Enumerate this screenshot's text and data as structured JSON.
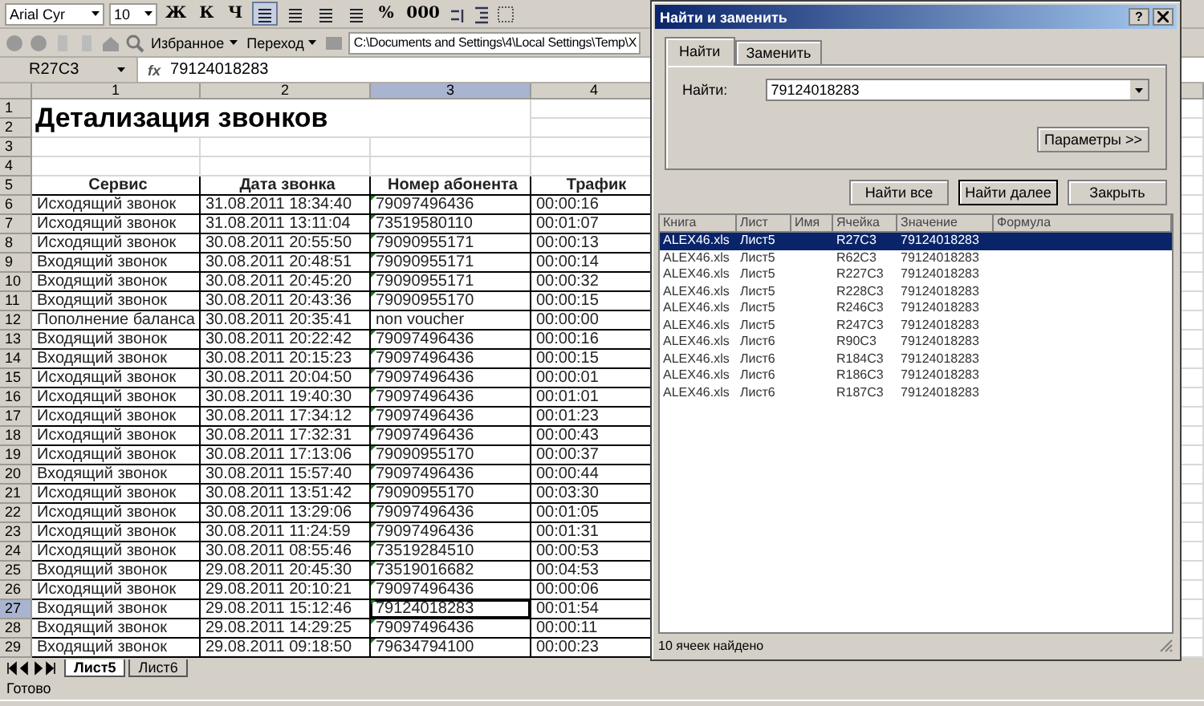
{
  "toolbar": {
    "font": "Arial Cyr",
    "size": "10",
    "format_buttons": [
      "Ж",
      "К",
      "Ч"
    ],
    "number_buttons": [
      "%",
      "000"
    ]
  },
  "web_toolbar": {
    "favorites": "Избранное",
    "go": "Переход",
    "address": "C:\\Documents and Settings\\4\\Local Settings\\Temp\\X"
  },
  "formula_bar": {
    "name_box": "R27C3",
    "fx": "fx",
    "value": "79124018283"
  },
  "columns": [
    {
      "label": "1",
      "selected": false
    },
    {
      "label": "2",
      "selected": false
    },
    {
      "label": "3",
      "selected": true
    },
    {
      "label": "4",
      "selected": false
    }
  ],
  "top_rows": [
    "1",
    "2",
    "3",
    "4",
    "5"
  ],
  "title": "Детализация звонков",
  "table_header": [
    "Сервис",
    "Дата звонка",
    "Номер абонента",
    "Трафик"
  ],
  "rows": [
    {
      "number": "6",
      "selected": false,
      "cells": [
        "Исходящий звонок",
        "31.08.2011 18:34:40",
        "79097496436",
        "00:00:16"
      ],
      "flag": true
    },
    {
      "number": "7",
      "selected": false,
      "cells": [
        "Исходящий звонок",
        "31.08.2011 13:11:04",
        "73519580110",
        "00:01:07"
      ],
      "flag": true
    },
    {
      "number": "8",
      "selected": false,
      "cells": [
        "Исходящий звонок",
        "30.08.2011 20:55:50",
        "79090955171",
        "00:00:13"
      ],
      "flag": true
    },
    {
      "number": "9",
      "selected": false,
      "cells": [
        "Входящий звонок",
        "30.08.2011 20:48:51",
        "79090955171",
        "00:00:14"
      ],
      "flag": true
    },
    {
      "number": "10",
      "selected": false,
      "cells": [
        "Входящий звонок",
        "30.08.2011 20:45:20",
        "79090955171",
        "00:00:32"
      ],
      "flag": true
    },
    {
      "number": "11",
      "selected": false,
      "cells": [
        "Входящий звонок",
        "30.08.2011 20:43:36",
        "79090955170",
        "00:00:15"
      ],
      "flag": true
    },
    {
      "number": "12",
      "selected": false,
      "cells": [
        "Пополнение баланса",
        "30.08.2011 20:35:41",
        "non voucher",
        "00:00:00"
      ],
      "flag": false
    },
    {
      "number": "13",
      "selected": false,
      "cells": [
        "Входящий звонок",
        "30.08.2011 20:22:42",
        "79097496436",
        "00:00:16"
      ],
      "flag": true
    },
    {
      "number": "14",
      "selected": false,
      "cells": [
        "Входящий звонок",
        "30.08.2011 20:15:23",
        "79097496436",
        "00:00:15"
      ],
      "flag": true
    },
    {
      "number": "15",
      "selected": false,
      "cells": [
        "Исходящий звонок",
        "30.08.2011 20:04:50",
        "79097496436",
        "00:00:01"
      ],
      "flag": true
    },
    {
      "number": "16",
      "selected": false,
      "cells": [
        "Исходящий звонок",
        "30.08.2011 19:40:30",
        "79097496436",
        "00:01:01"
      ],
      "flag": true
    },
    {
      "number": "17",
      "selected": false,
      "cells": [
        "Исходящий звонок",
        "30.08.2011 17:34:12",
        "79097496436",
        "00:01:23"
      ],
      "flag": true
    },
    {
      "number": "18",
      "selected": false,
      "cells": [
        "Исходящий звонок",
        "30.08.2011 17:32:31",
        "79097496436",
        "00:00:43"
      ],
      "flag": true
    },
    {
      "number": "19",
      "selected": false,
      "cells": [
        "Исходящий звонок",
        "30.08.2011 17:13:06",
        "79090955170",
        "00:00:37"
      ],
      "flag": true
    },
    {
      "number": "20",
      "selected": false,
      "cells": [
        "Входящий звонок",
        "30.08.2011 15:57:40",
        "79097496436",
        "00:00:44"
      ],
      "flag": true
    },
    {
      "number": "21",
      "selected": false,
      "cells": [
        "Исходящий звонок",
        "30.08.2011 13:51:42",
        "79090955170",
        "00:03:30"
      ],
      "flag": true
    },
    {
      "number": "22",
      "selected": false,
      "cells": [
        "Исходящий звонок",
        "30.08.2011 13:29:06",
        "79097496436",
        "00:01:05"
      ],
      "flag": true
    },
    {
      "number": "23",
      "selected": false,
      "cells": [
        "Исходящий звонок",
        "30.08.2011 11:24:59",
        "79097496436",
        "00:01:31"
      ],
      "flag": true
    },
    {
      "number": "24",
      "selected": false,
      "cells": [
        "Исходящий звонок",
        "30.08.2011 08:55:46",
        "73519284510",
        "00:00:53"
      ],
      "flag": true
    },
    {
      "number": "25",
      "selected": false,
      "cells": [
        "Входящий звонок",
        "29.08.2011 20:45:30",
        "73519016682",
        "00:04:53"
      ],
      "flag": true
    },
    {
      "number": "26",
      "selected": false,
      "cells": [
        "Исходящий звонок",
        "29.08.2011 20:10:21",
        "79097496436",
        "00:00:06"
      ],
      "flag": true
    },
    {
      "number": "27",
      "selected": true,
      "cells": [
        "Входящий звонок",
        "29.08.2011 15:12:46",
        "79124018283",
        "00:01:54"
      ],
      "flag": true
    },
    {
      "number": "28",
      "selected": false,
      "cells": [
        "Входящий звонок",
        "29.08.2011 14:29:25",
        "79097496436",
        "00:00:11"
      ],
      "flag": true
    },
    {
      "number": "29",
      "selected": false,
      "cells": [
        "Входящий звонок",
        "29.08.2011 09:18:50",
        "79634794100",
        "00:00:23"
      ],
      "flag": true
    }
  ],
  "sheet_tabs": [
    {
      "label": "Лист5",
      "selected": true
    },
    {
      "label": "Лист6",
      "selected": false
    }
  ],
  "status_bar": "Готово",
  "dialog": {
    "title": "Найти и заменить",
    "help": "?",
    "tabs": [
      {
        "label": "Найти",
        "selected": true
      },
      {
        "label": "Заменить",
        "selected": false
      }
    ],
    "find_label": "Найти:",
    "find_value": "79124018283",
    "options_button": "Параметры >>",
    "buttons": [
      "Найти все",
      "Найти далее",
      "Закрыть"
    ],
    "result_columns": [
      "Книга",
      "Лист",
      "Имя",
      "Ячейка",
      "Значение",
      "Формула"
    ],
    "results": [
      {
        "selected": true,
        "cells": [
          "ALEX46.xls",
          "Лист5",
          "",
          "R27C3",
          "79124018283",
          ""
        ]
      },
      {
        "selected": false,
        "cells": [
          "ALEX46.xls",
          "Лист5",
          "",
          "R62C3",
          "79124018283",
          ""
        ]
      },
      {
        "selected": false,
        "cells": [
          "ALEX46.xls",
          "Лист5",
          "",
          "R227C3",
          "79124018283",
          ""
        ]
      },
      {
        "selected": false,
        "cells": [
          "ALEX46.xls",
          "Лист5",
          "",
          "R228C3",
          "79124018283",
          ""
        ]
      },
      {
        "selected": false,
        "cells": [
          "ALEX46.xls",
          "Лист5",
          "",
          "R246C3",
          "79124018283",
          ""
        ]
      },
      {
        "selected": false,
        "cells": [
          "ALEX46.xls",
          "Лист5",
          "",
          "R247C3",
          "79124018283",
          ""
        ]
      },
      {
        "selected": false,
        "cells": [
          "ALEX46.xls",
          "Лист6",
          "",
          "R90C3",
          "79124018283",
          ""
        ]
      },
      {
        "selected": false,
        "cells": [
          "ALEX46.xls",
          "Лист6",
          "",
          "R184C3",
          "79124018283",
          ""
        ]
      },
      {
        "selected": false,
        "cells": [
          "ALEX46.xls",
          "Лист6",
          "",
          "R186C3",
          "79124018283",
          ""
        ]
      },
      {
        "selected": false,
        "cells": [
          "ALEX46.xls",
          "Лист6",
          "",
          "R187C3",
          "79124018283",
          ""
        ]
      }
    ],
    "result_status": "10 ячеек найдено"
  }
}
